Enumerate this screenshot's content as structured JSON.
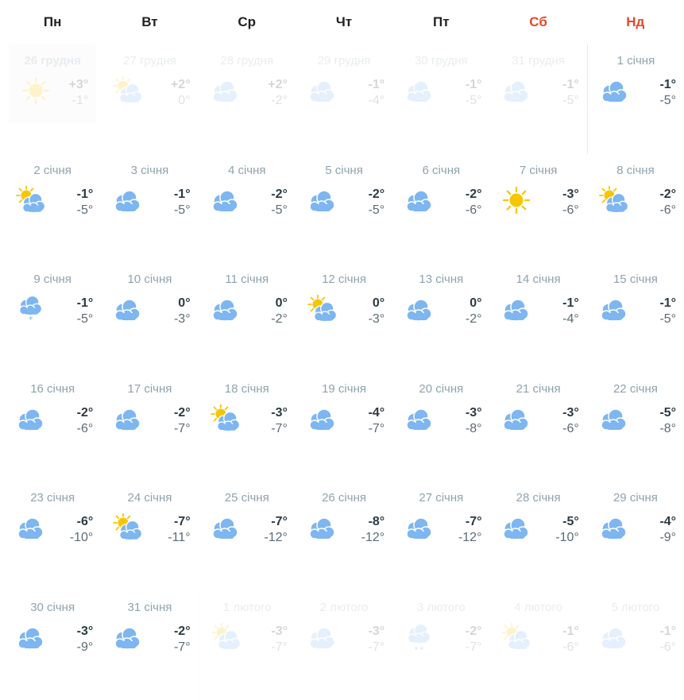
{
  "colors": {
    "weekend_header": "#e8472a",
    "date_text": "#8fa3ad",
    "cloud": "#7db6f0",
    "sun": "#f7c600"
  },
  "weekdays": [
    {
      "label": "Пн",
      "weekend": false
    },
    {
      "label": "Вт",
      "weekend": false
    },
    {
      "label": "Ср",
      "weekend": false
    },
    {
      "label": "Чт",
      "weekend": false
    },
    {
      "label": "Пт",
      "weekend": false
    },
    {
      "label": "Сб",
      "weekend": true
    },
    {
      "label": "Нд",
      "weekend": true
    }
  ],
  "days": [
    {
      "date": "26 грудня",
      "max": "+3°",
      "min": "-1°",
      "icon": "sun-icon",
      "other": true,
      "today": true
    },
    {
      "date": "27 грудня",
      "max": "+2°",
      "min": "0°",
      "icon": "partly-cloudy-icon",
      "other": true
    },
    {
      "date": "28 грудня",
      "max": "+2°",
      "min": "-2°",
      "icon": "cloudy-icon",
      "other": true
    },
    {
      "date": "29 грудня",
      "max": "-1°",
      "min": "-4°",
      "icon": "cloudy-icon",
      "other": true
    },
    {
      "date": "30 грудня",
      "max": "-1°",
      "min": "-5°",
      "icon": "cloudy-icon",
      "other": true
    },
    {
      "date": "31 грудня",
      "max": "-1°",
      "min": "-5°",
      "icon": "cloudy-icon",
      "other": true
    },
    {
      "date": "1 січня",
      "max": "-1°",
      "min": "-5°",
      "icon": "cloudy-icon",
      "startsep": true
    },
    {
      "date": "2 січня",
      "max": "-1°",
      "min": "-5°",
      "icon": "partly-cloudy-icon"
    },
    {
      "date": "3 січня",
      "max": "-1°",
      "min": "-5°",
      "icon": "cloudy-icon"
    },
    {
      "date": "4 січня",
      "max": "-2°",
      "min": "-5°",
      "icon": "cloudy-icon"
    },
    {
      "date": "5 січня",
      "max": "-2°",
      "min": "-5°",
      "icon": "cloudy-icon"
    },
    {
      "date": "6 січня",
      "max": "-2°",
      "min": "-6°",
      "icon": "cloudy-icon"
    },
    {
      "date": "7 січня",
      "max": "-3°",
      "min": "-6°",
      "icon": "sun-icon"
    },
    {
      "date": "8 січня",
      "max": "-2°",
      "min": "-6°",
      "icon": "partly-cloudy-icon"
    },
    {
      "date": "9 січня",
      "max": "-1°",
      "min": "-5°",
      "icon": "snow-icon"
    },
    {
      "date": "10 січня",
      "max": "0°",
      "min": "-3°",
      "icon": "cloudy-icon"
    },
    {
      "date": "11 січня",
      "max": "0°",
      "min": "-2°",
      "icon": "cloudy-icon"
    },
    {
      "date": "12 січня",
      "max": "0°",
      "min": "-3°",
      "icon": "partly-cloudy-icon"
    },
    {
      "date": "13 січня",
      "max": "0°",
      "min": "-2°",
      "icon": "cloudy-icon"
    },
    {
      "date": "14 січня",
      "max": "-1°",
      "min": "-4°",
      "icon": "cloudy-icon"
    },
    {
      "date": "15 січня",
      "max": "-1°",
      "min": "-5°",
      "icon": "cloudy-icon"
    },
    {
      "date": "16 січня",
      "max": "-2°",
      "min": "-6°",
      "icon": "cloudy-icon"
    },
    {
      "date": "17 січня",
      "max": "-2°",
      "min": "-7°",
      "icon": "cloudy-icon"
    },
    {
      "date": "18 січня",
      "max": "-3°",
      "min": "-7°",
      "icon": "partly-cloudy-icon"
    },
    {
      "date": "19 січня",
      "max": "-4°",
      "min": "-7°",
      "icon": "cloudy-icon"
    },
    {
      "date": "20 січня",
      "max": "-3°",
      "min": "-8°",
      "icon": "cloudy-icon"
    },
    {
      "date": "21 січня",
      "max": "-3°",
      "min": "-6°",
      "icon": "cloudy-icon"
    },
    {
      "date": "22 січня",
      "max": "-5°",
      "min": "-8°",
      "icon": "cloudy-icon"
    },
    {
      "date": "23 січня",
      "max": "-6°",
      "min": "-10°",
      "icon": "cloudy-icon"
    },
    {
      "date": "24 січня",
      "max": "-7°",
      "min": "-11°",
      "icon": "partly-cloudy-icon"
    },
    {
      "date": "25 січня",
      "max": "-7°",
      "min": "-12°",
      "icon": "cloudy-icon"
    },
    {
      "date": "26 січня",
      "max": "-8°",
      "min": "-12°",
      "icon": "cloudy-icon"
    },
    {
      "date": "27 січня",
      "max": "-7°",
      "min": "-12°",
      "icon": "cloudy-icon"
    },
    {
      "date": "28 січня",
      "max": "-5°",
      "min": "-10°",
      "icon": "cloudy-icon"
    },
    {
      "date": "29 січня",
      "max": "-4°",
      "min": "-9°",
      "icon": "cloudy-icon"
    },
    {
      "date": "30 січня",
      "max": "-3°",
      "min": "-9°",
      "icon": "cloudy-icon"
    },
    {
      "date": "31 січня",
      "max": "-2°",
      "min": "-7°",
      "icon": "cloudy-icon"
    },
    {
      "date": "1 лютого",
      "max": "-3°",
      "min": "-7°",
      "icon": "partly-cloudy-icon",
      "other": true,
      "startsep": true
    },
    {
      "date": "2 лютого",
      "max": "-3°",
      "min": "-7°",
      "icon": "cloudy-icon",
      "other": true
    },
    {
      "date": "3 лютого",
      "max": "-2°",
      "min": "-7°",
      "icon": "rain-icon",
      "other": true
    },
    {
      "date": "4 лютого",
      "max": "-1°",
      "min": "-6°",
      "icon": "partly-cloudy-icon",
      "other": true
    },
    {
      "date": "5 лютого",
      "max": "-1°",
      "min": "-6°",
      "icon": "cloudy-icon",
      "other": true
    }
  ]
}
